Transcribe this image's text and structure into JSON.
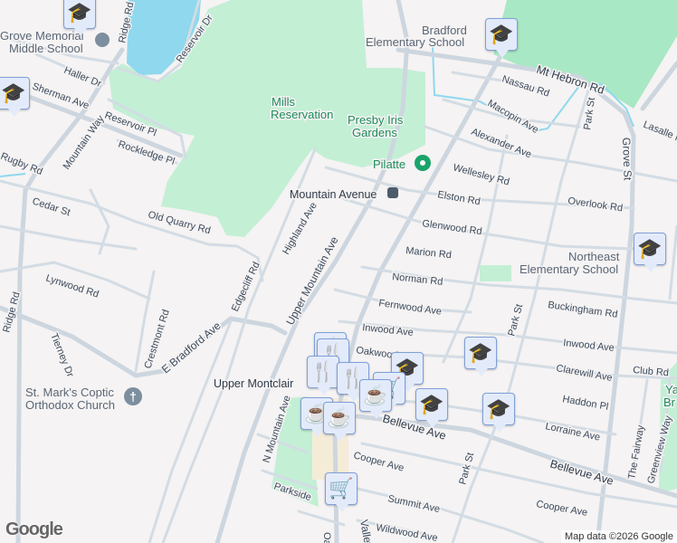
{
  "map": {
    "streets": [
      "Ridge Rd",
      "Reservoir Dr",
      "Haller Dr",
      "Sherman Ave",
      "Reservoir Pl",
      "Rockledge Pl",
      "Mountain Way",
      "Rugby Rd",
      "Cedar St",
      "Old Quarry Rd",
      "Highland Ave",
      "Upper Mountain Ave",
      "Edgecliff Rd",
      "E Bradford Ave",
      "Lynwood Rd",
      "Crestmont Rd",
      "Tierney Dr",
      "Ridge Rd",
      "N Mountain Ave",
      "Parkside",
      "Mt Hebron Rd",
      "Nassau Rd",
      "Macopin Ave",
      "Alexander Ave",
      "Wellesley Rd",
      "Elston Rd",
      "Overlook Rd",
      "Glenwood Rd",
      "Marion Rd",
      "Norman Rd",
      "Fernwood Ave",
      "Buckingham Rd",
      "Inwood Ave",
      "Inwood Ave",
      "Clarewill Ave",
      "Club Rd",
      "Haddon Pl",
      "Lorraine Ave",
      "Bellevue Ave",
      "Bellevue Ave",
      "Cooper Ave",
      "Cooper Ave",
      "Summit Ave",
      "Park St",
      "Park St",
      "Park St",
      "Grove St",
      "Lasalle Rd",
      "The Fairway",
      "Greenview Way",
      "Wildwood Ave",
      "Valley Rd",
      "Oakwood Ave",
      "Oak"
    ],
    "places": {
      "grove_memorial": "Grove Memorial Middle School",
      "grove_memorial_l1": "Grove Memorial",
      "grove_memorial_l2": "Middle School",
      "mills_l1": "Mills",
      "mills_l2": "Reservation",
      "presby_l1": "Presby Iris",
      "presby_l2": "Gardens",
      "pilatte": "Pilatte",
      "mountain_avenue": "Mountain Avenue",
      "bradford_l1": "Bradford",
      "bradford_l2": "Elementary School",
      "northeast_l1": "Northeast",
      "northeast_l2": "Elementary School",
      "st_marks_l1": "St. Mark's Coptic",
      "st_marks_l2": "Orthodox Church",
      "upper_montclair": "Upper Montclair",
      "yantacaw_l1": "Ya",
      "yantacaw_l2": "Br"
    },
    "colors": {
      "land": "#f5f3f3",
      "park": "#c3efd5",
      "water": "#8fd8ee",
      "marker": "#e3ebfb",
      "marker_icon": "#0d3a5c"
    }
  },
  "attribution": "Map data ©2026 Google",
  "logo": "Google"
}
